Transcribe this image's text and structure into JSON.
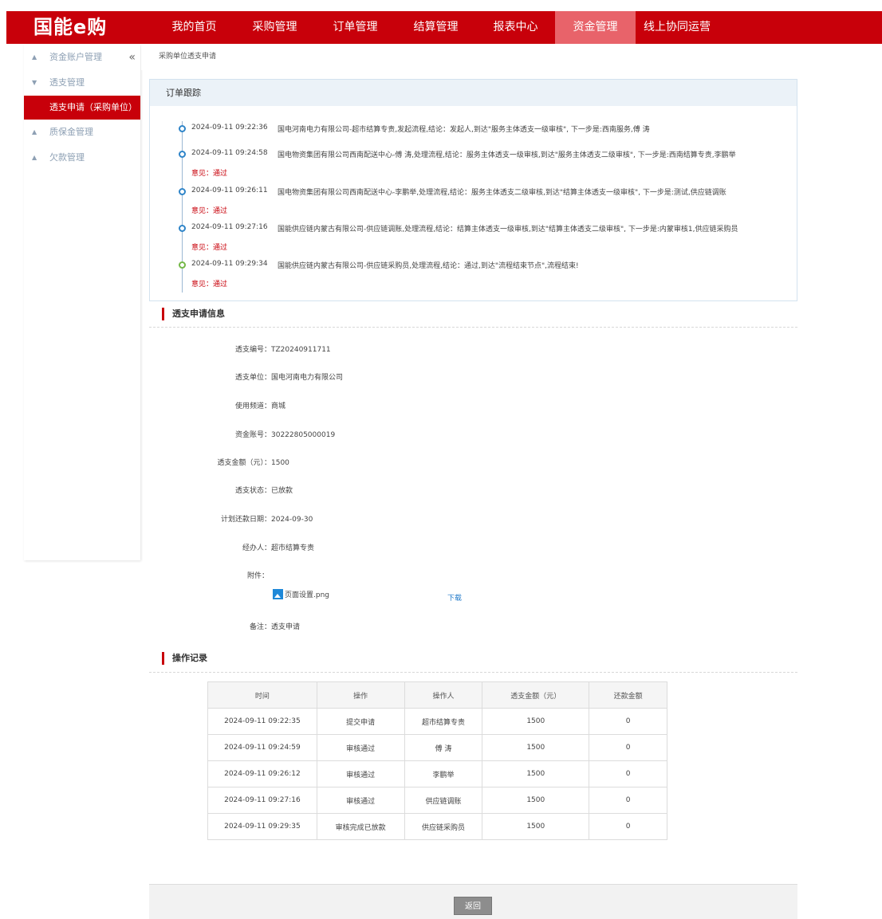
{
  "header": {
    "logo": "国能e购",
    "nav": [
      {
        "label": "我的首页"
      },
      {
        "label": "采购管理"
      },
      {
        "label": "订单管理"
      },
      {
        "label": "结算管理"
      },
      {
        "label": "报表中心"
      },
      {
        "label": "资金管理",
        "active": true
      },
      {
        "label": "线上协同运营"
      }
    ]
  },
  "sidebar": {
    "collapse_icon": "double-chevron-left-icon",
    "items": [
      {
        "label": "资金账户管理",
        "expanded": false
      },
      {
        "label": "透支管理",
        "expanded": true
      },
      {
        "label": "透支申请（采购单位）",
        "active": true
      },
      {
        "label": "质保金管理",
        "expanded": false
      },
      {
        "label": "欠款管理",
        "expanded": false
      }
    ]
  },
  "breadcrumb": "采购单位透支申请",
  "tracking": {
    "title": "订单跟踪",
    "entries": [
      {
        "time": "2024-09-11 09:22:36",
        "text": "国电河南电力有限公司-超市结算专责,发起流程,结论：发起人,到达\"服务主体透支一级审核\", 下一步是:西南服务,傅 涛",
        "opinion": ""
      },
      {
        "time": "2024-09-11 09:24:58",
        "text": "国电物资集团有限公司西南配送中心-傅 涛,处理流程,结论：服务主体透支一级审核,到达\"服务主体透支二级审核\", 下一步是:西南结算专责,李鹏举",
        "opinion": "意见：通过"
      },
      {
        "time": "2024-09-11 09:26:11",
        "text": "国电物资集团有限公司西南配送中心-李鹏举,处理流程,结论：服务主体透支二级审核,到达\"结算主体透支一级审核\", 下一步是:测试,供应链调账",
        "opinion": "意见：通过"
      },
      {
        "time": "2024-09-11 09:27:16",
        "text": "国能供应链内蒙古有限公司-供应链调账,处理流程,结论：结算主体透支一级审核,到达\"结算主体透支二级审核\", 下一步是:内蒙审核1,供应链采购员",
        "opinion": "意见：通过"
      },
      {
        "time": "2024-09-11 09:29:34",
        "text": "国能供应链内蒙古有限公司-供应链采购员,处理流程,结论：通过,到达\"流程结束节点\",流程结束!",
        "opinion": "意见：通过"
      }
    ]
  },
  "info": {
    "title": "透支申请信息",
    "fields": [
      {
        "label": "透支编号：",
        "value": "TZ20240911711"
      },
      {
        "label": "透支单位：",
        "value": "国电河南电力有限公司"
      },
      {
        "label": "使用频道：",
        "value": "商城"
      },
      {
        "label": "资金账号：",
        "value": "30222805000019"
      },
      {
        "label": "透支金额（元）：",
        "value": "1500"
      },
      {
        "label": "透支状态：",
        "value": "已放款"
      },
      {
        "label": "计划还款日期：",
        "value": "2024-09-30"
      },
      {
        "label": "经办人：",
        "value": "超市结算专责"
      },
      {
        "label": "附件：",
        "value": ""
      }
    ],
    "attachment": {
      "name": "页面设置.png",
      "icon": "image-file-icon",
      "download": "下载"
    },
    "remark": {
      "label": "备注：",
      "value": "透支申请"
    }
  },
  "log": {
    "title": "操作记录",
    "columns": [
      "时间",
      "操作",
      "操作人",
      "透支金额（元）",
      "还款金额"
    ],
    "rows": [
      [
        "2024-09-11 09:22:35",
        "提交申请",
        "超市结算专责",
        "1500",
        "0"
      ],
      [
        "2024-09-11 09:24:59",
        "审核通过",
        "傅 涛",
        "1500",
        "0"
      ],
      [
        "2024-09-11 09:26:12",
        "审核通过",
        "李鹏举",
        "1500",
        "0"
      ],
      [
        "2024-09-11 09:27:16",
        "审核通过",
        "供应链调账",
        "1500",
        "0"
      ],
      [
        "2024-09-11 09:29:35",
        "审核完成已放款",
        "供应链采购员",
        "1500",
        "0"
      ]
    ]
  },
  "footer": {
    "back_label": "返回"
  },
  "colors": {
    "brand": "#c8000a",
    "nav_active": "#e8636a",
    "link": "#1e78c8",
    "dot_blue": "#2e84c8",
    "dot_green": "#74b847"
  }
}
